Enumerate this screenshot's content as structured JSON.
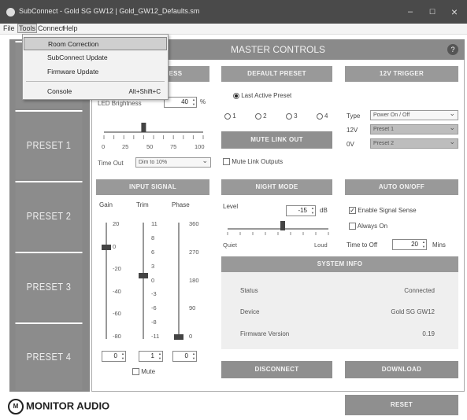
{
  "window": {
    "title": "SubConnect - Gold SG GW12 | Gold_GW12_Defaults.sm",
    "minimize": "–",
    "maximize": "☐",
    "close": "×"
  },
  "menu": [
    "File",
    "Tools",
    "Connect",
    "Help"
  ],
  "tools_menu": {
    "items": [
      "Room Correction",
      "SubConnect Update",
      "Firmware Update",
      "Console"
    ],
    "console_shortcut": "Alt+Shift+C"
  },
  "header": {
    "title": "MASTER CONTROLS",
    "help": "?"
  },
  "presets": [
    "PRESET 1",
    "PRESET 2",
    "PRESET 3",
    "PRESET 4"
  ],
  "brightness": {
    "header": "LED BRIGHTNESS",
    "label": "LED Brightness",
    "value": "40",
    "unit": "%",
    "ticks": [
      "0",
      "25",
      "50",
      "75",
      "100"
    ],
    "level": 40,
    "timeout_label": "Time Out",
    "timeout_value": "Dim to 10%"
  },
  "default_preset": {
    "header": "DEFAULT PRESET",
    "last_active": "Last Active Preset",
    "options": [
      "1",
      "2",
      "3",
      "4"
    ]
  },
  "mute_link": {
    "button": "MUTE LINK OUT",
    "checkbox": "Mute Link Outputs"
  },
  "trigger": {
    "header": "12V TRIGGER",
    "type_label": "Type",
    "type_value": "Power On / Off",
    "v12_label": "12V",
    "v12_value": "Preset 1",
    "v0_label": "0V",
    "v0_value": "Preset 2"
  },
  "input_signal": {
    "header": "INPUT SIGNAL",
    "gain_label": "Gain",
    "trim_label": "Trim",
    "phase_label": "Phase",
    "gain_ticks": [
      "20",
      "0",
      "-20",
      "-40",
      "-60",
      "-80"
    ],
    "trim_ticks": [
      "11",
      "8",
      "6",
      "3",
      "0",
      "-3",
      "-6",
      "-8",
      "-11"
    ],
    "phase_ticks": [
      "360",
      "270",
      "180",
      "90",
      "0"
    ],
    "gain_value": "0",
    "trim_value": "1",
    "phase_value": "0",
    "gain_level": 0,
    "trim_level": 1,
    "phase_level": 0,
    "mute": "Mute"
  },
  "night_mode": {
    "header": "NIGHT MODE",
    "level_label": "Level",
    "level_value": "-15",
    "unit": "dB",
    "quiet": "Quiet",
    "loud": "Loud"
  },
  "auto_onoff": {
    "header": "AUTO ON/OFF",
    "enable": "Enable Signal Sense",
    "always_on": "Always On",
    "time_label": "Time to Off",
    "time_value": "20",
    "time_unit": "Mins"
  },
  "system_info": {
    "header": "SYSTEM INFO",
    "status_label": "Status",
    "status_value": "Connected",
    "device_label": "Device",
    "device_value": "Gold SG GW12",
    "firmware_label": "Firmware Version",
    "firmware_value": "0.19"
  },
  "buttons": {
    "disconnect": "DISCONNECT",
    "download": "DOWNLOAD",
    "reset": "RESET"
  },
  "logo": {
    "mark": "M",
    "text": "MONITOR AUDIO"
  }
}
